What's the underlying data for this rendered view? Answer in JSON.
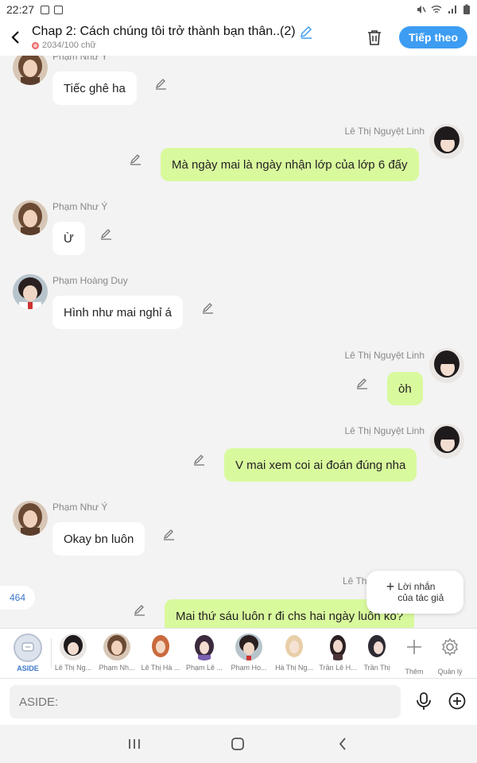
{
  "status_bar": {
    "time": "22:27"
  },
  "header": {
    "title": "Chap 2: Cách chúng tôi trở thành bạn thân..(2)",
    "subtitle": "2034/100 chữ",
    "follow_label": "Tiếp theo"
  },
  "messages": [
    {
      "sender": "Phạm Như Ý",
      "text": "Tiếc ghê ha",
      "side": "left",
      "avatar": "girl-brown"
    },
    {
      "sender": "Lê Thị Nguyệt Linh",
      "text": "Mà ngày mai là ngày nhận lớp của lớp 6 đấy",
      "side": "right",
      "avatar": "girl-dark"
    },
    {
      "sender": "Phạm Như Ý",
      "text": "Ừ",
      "side": "left",
      "avatar": "girl-brown"
    },
    {
      "sender": "Phạm Hoàng Duy",
      "text": "Hình như mai nghỉ á",
      "side": "left",
      "avatar": "boy-dark"
    },
    {
      "sender": "Lê Thị Nguyệt Linh",
      "text": "òh",
      "side": "right",
      "avatar": "girl-dark"
    },
    {
      "sender": "Lê Thị Nguyệt Linh",
      "text": "V mai xem coi ai đoán đúng nha",
      "side": "right",
      "avatar": "girl-dark"
    },
    {
      "sender": "Phạm Như Ý",
      "text": "Okay bn luôn",
      "side": "left",
      "avatar": "girl-brown"
    },
    {
      "sender": "Lê Thị",
      "text": "Mai thứ sáu luôn r đi chs hai ngày luôn ko?",
      "side": "right",
      "avatar": "girl-dark"
    }
  ],
  "counter": "464",
  "author_note": {
    "line1": "Lời nhắn",
    "line2": "của tác giả"
  },
  "characters": [
    {
      "label": "ASIDE",
      "active": true
    },
    {
      "label": "Lê Thị Ng..."
    },
    {
      "label": "Phạm Nh..."
    },
    {
      "label": "Lê Thị Hà ..."
    },
    {
      "label": "Phạm Lê ..."
    },
    {
      "label": "Phạm Ho..."
    },
    {
      "label": "Hà Thị Ng..."
    },
    {
      "label": "Trần Lê H..."
    },
    {
      "label": "Trần Thị"
    }
  ],
  "tools": {
    "add_label": "Thêm",
    "manage_label": "Quản lý"
  },
  "input": {
    "placeholder": "ASIDE:"
  },
  "colors": {
    "accent": "#3d9df2",
    "my_bubble": "#d9f99d",
    "other_bubble": "#ffffff",
    "background": "#f3f3f3"
  }
}
